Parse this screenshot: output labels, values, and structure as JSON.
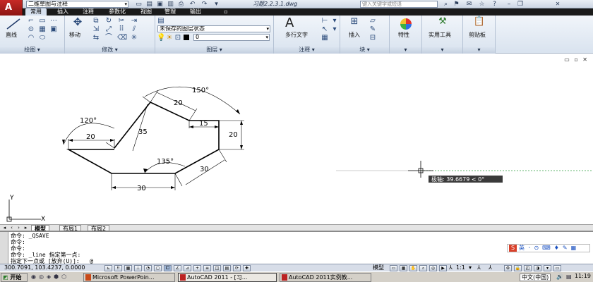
{
  "title_bar": {
    "app_button_letter": "A",
    "workspace": "二维草图与注释",
    "doc_title": "习题2.2.3.1.dwg",
    "search_placeholder": "键入关键字或短语"
  },
  "ribbon_tabs": [
    "常用",
    "插入",
    "注释",
    "参数化",
    "视图",
    "管理",
    "输出"
  ],
  "ribbon": {
    "draw": {
      "title": "绘图",
      "line_label": "直线"
    },
    "modify": {
      "title": "修改",
      "move_label": "移动"
    },
    "layers": {
      "title": "图层",
      "layer_state": "未保存的图层状态",
      "current_layer": "0"
    },
    "annotation": {
      "title": "注释",
      "mtext_label": "多行文字",
      "mtext_glyph": "A"
    },
    "block": {
      "title": "块",
      "insert_label": "插入"
    },
    "properties": {
      "label": "特性"
    },
    "utilities": {
      "label": "实用工具"
    },
    "clipboard": {
      "label": "剪贴板"
    }
  },
  "drawing": {
    "dims": {
      "d20_top": "20",
      "d35": "35",
      "d15": "15",
      "d20_right": "20",
      "d20_left": "20",
      "d30_bottom": "30",
      "d30_right": "30",
      "a150": "150°",
      "a120": "120°",
      "a135": "135°"
    },
    "ucs_y": "Y",
    "ucs_x": "X",
    "polar_tooltip": "极轴: 39.6679 < 0°"
  },
  "layout_tabs": [
    "模型",
    "布局1",
    "布局2"
  ],
  "command_lines": [
    "命令: _QSAVE",
    "命令:",
    "命令:",
    "命令: _line 指定第一点:",
    "指定下一点或 [放弃(U)]:   @"
  ],
  "status_bar": {
    "coords": "300.7091, 103.4237, 0.0000",
    "model_label": "模型",
    "annotation_scale": "1:1"
  },
  "ime": {
    "label": "英"
  },
  "taskbar": {
    "start_label": "开始",
    "tasks": [
      "Microsoft PowerPoin...",
      "AutoCAD 2011 - [习...",
      "AutoCAD 2011实例教..."
    ],
    "lang": "中文(中国)",
    "clock": "11:19"
  },
  "colors": {
    "app_red": "#b51f1c",
    "tab_bar": "#1a1a1a",
    "ribbon_bg": "#e3eaf3",
    "polar_track": "#2c9c3c"
  }
}
